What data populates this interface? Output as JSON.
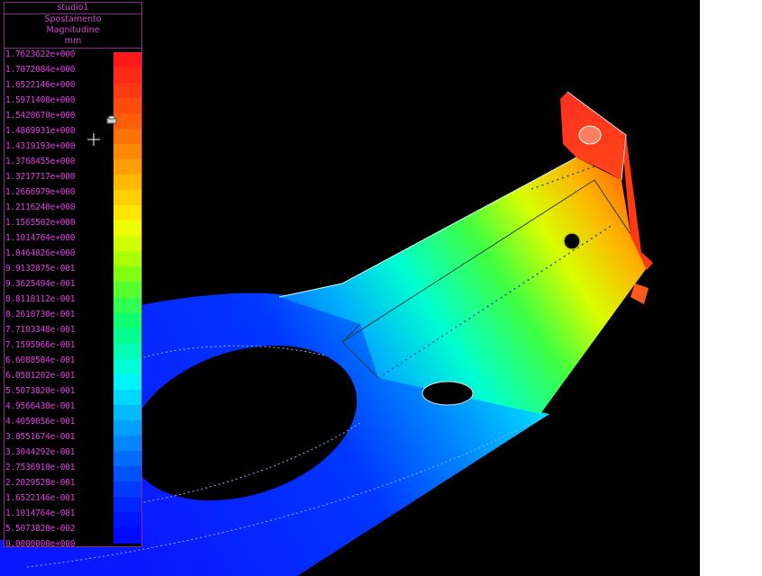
{
  "legend": {
    "study_name": "studio1",
    "result_type": "Spostamento",
    "component": "Magnitudine",
    "unit": "mm",
    "ticks": [
      "1.7623622e+000",
      "1.7072084e+000",
      "1.6522146e+000",
      "1.5971408e+000",
      "1.5420670e+000",
      "1.4869931e+000",
      "1.4319193e+000",
      "1.3768455e+000",
      "1.3217717e+000",
      "1.2666979e+000",
      "1.2116240e+000",
      "1.1565502e+000",
      "1.1014764e+000",
      "1.0464026e+000",
      "9.9132075e-001",
      "9.3625494e-001",
      "8.8118112e-001",
      "8.2610730e-001",
      "7.7103348e-001",
      "7.1595966e-001",
      "6.6088584e-001",
      "6.0581202e-001",
      "5.5073820e-001",
      "4.9566438e-001",
      "4.4059056e-001",
      "3.8551674e-001",
      "3.3044292e-001",
      "2.7536910e-001",
      "2.2029528e-001",
      "1.6522146e-001",
      "1.1014764e-001",
      "5.5073820e-002",
      "0.0000000e+000"
    ],
    "colors": [
      "#ff1a1a",
      "#ff2a14",
      "#ff3a10",
      "#ff4c0c",
      "#ff5e08",
      "#ff7204",
      "#ff8800",
      "#ffa000",
      "#ffb800",
      "#ffd000",
      "#ffe800",
      "#f0ff00",
      "#d0ff00",
      "#aaff00",
      "#80ff10",
      "#55ff30",
      "#30ff50",
      "#10ff70",
      "#00ff90",
      "#00ffb4",
      "#00ffd8",
      "#00f4ff",
      "#00d8ff",
      "#00bcff",
      "#00a0ff",
      "#0086ff",
      "#006cff",
      "#0052ff",
      "#003aff",
      "#0026ff",
      "#0016ff",
      "#0008ff"
    ]
  },
  "viewport": {
    "background": "#000000"
  }
}
